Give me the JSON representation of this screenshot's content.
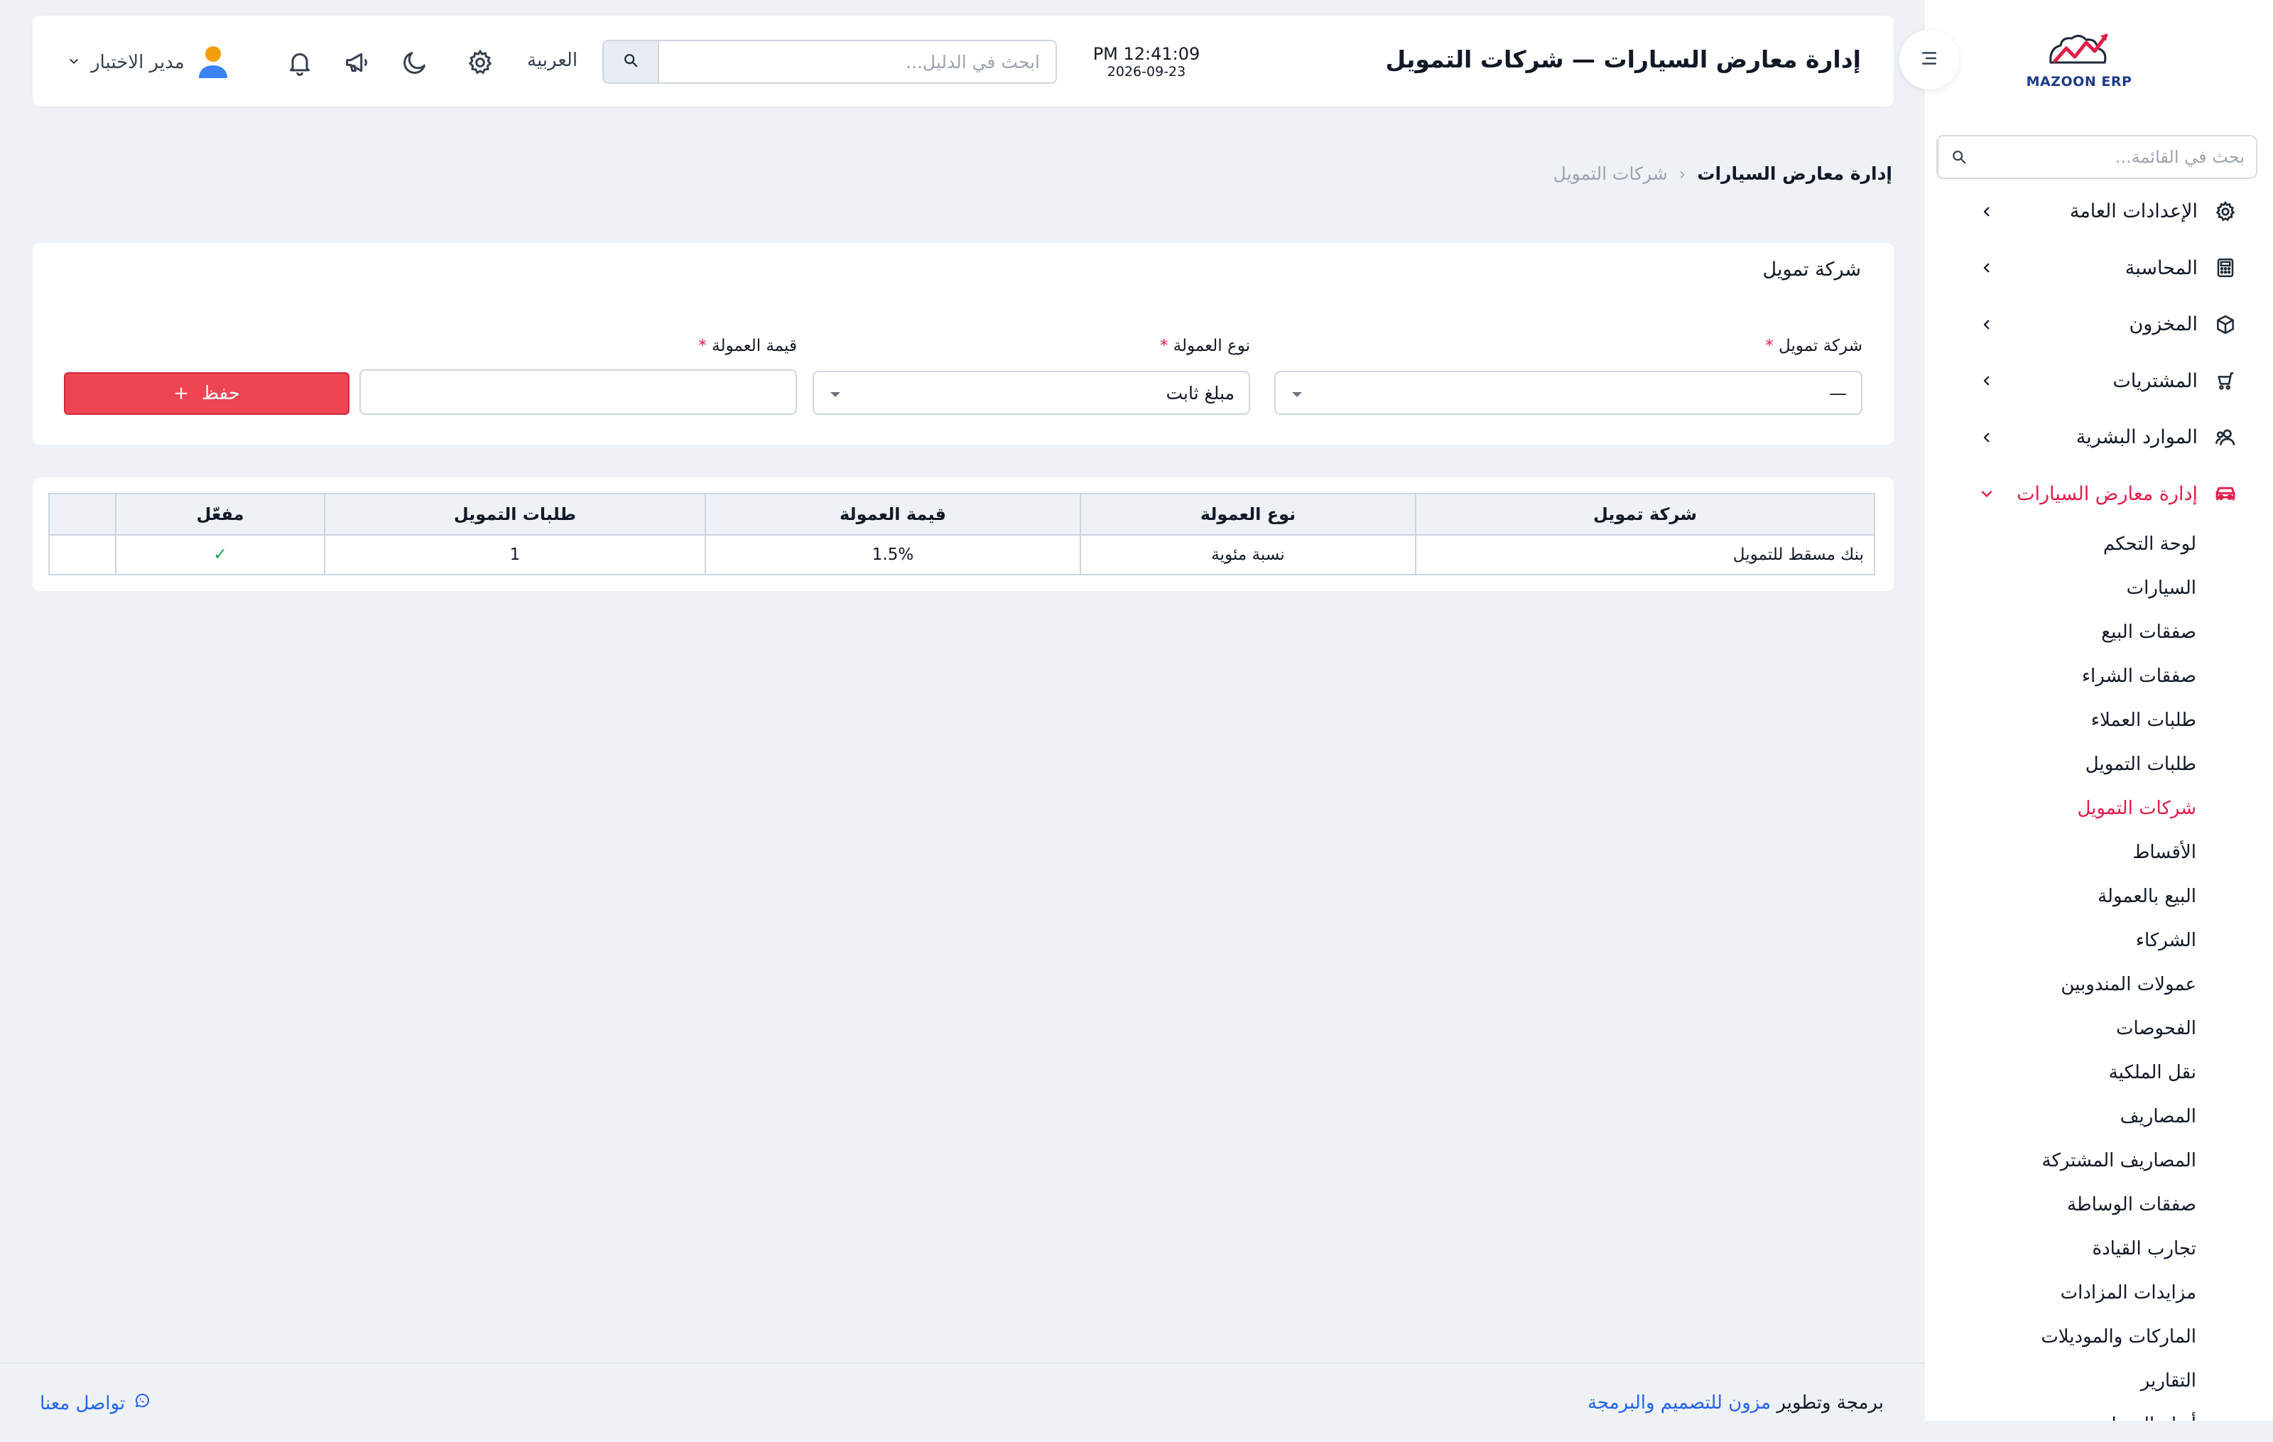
{
  "sidebar": {
    "logo_text": "MAZOON ERP",
    "search_placeholder": "بحث في القائمة...",
    "items": [
      {
        "label": "الإعدادات العامة",
        "icon": "gear-icon"
      },
      {
        "label": "المحاسبة",
        "icon": "calculator-icon"
      },
      {
        "label": "المخزون",
        "icon": "box-icon"
      },
      {
        "label": "المشتريات",
        "icon": "cart-icon"
      },
      {
        "label": "الموارد البشرية",
        "icon": "users-icon"
      },
      {
        "label": "إدارة معارض السيارات",
        "icon": "car-icon",
        "expanded": true
      }
    ],
    "sub_items": [
      "لوحة التحكم",
      "السيارات",
      "صفقات البيع",
      "صفقات الشراء",
      "طلبات العملاء",
      "طلبات التمويل",
      "شركات التمويل",
      "الأقساط",
      "البيع بالعمولة",
      "الشركاء",
      "عمولات المندوبين",
      "الفحوصات",
      "نقل الملكية",
      "المصاريف",
      "المصاريف المشتركة",
      "صفقات الوساطة",
      "تجارب القيادة",
      "مزايدات المزادات",
      "الماركات والموديلات",
      "التقارير",
      "أنواع المصاريف"
    ],
    "active_sub": "شركات التمويل",
    "accent_color": "#e11d48"
  },
  "topbar": {
    "title": "إدارة معارض السيارات — شركات التمويل",
    "time": "PM 12:41:09",
    "date": "2026-09-23",
    "search_placeholder": "ابحث في الدليل...",
    "language": "العربية",
    "user_name": "مدير الاختبار"
  },
  "breadcrumb": {
    "home": "إدارة معارض السيارات",
    "separator": "‹",
    "current": "شركات التمويل"
  },
  "form": {
    "title": "شركة تمويل",
    "company_label": "شركة تمويل",
    "company_value": "—",
    "commission_type_label": "نوع العمولة",
    "commission_type_value": "مبلغ ثابت",
    "commission_value_label": "قيمة العمولة",
    "commission_value": "",
    "required_mark": "*",
    "save_label": "حفظ",
    "save_icon": "+",
    "save_color": "#ef4452"
  },
  "table": {
    "headers": [
      "شركة تمويل",
      "نوع العمولة",
      "قيمة العمولة",
      "طلبات التمويل",
      "مفعّل",
      ""
    ],
    "rows": [
      {
        "company": "بنك مسقط للتمويل",
        "type": "نسبة مئوية",
        "value": "1.5%",
        "requests": "1",
        "enabled": "✓",
        "actions": ""
      }
    ]
  },
  "footer": {
    "credit_prefix": "برمجة وتطوير",
    "credit_link": "مزون للتصميم والبرمجة",
    "contact": "تواصل معنا"
  }
}
